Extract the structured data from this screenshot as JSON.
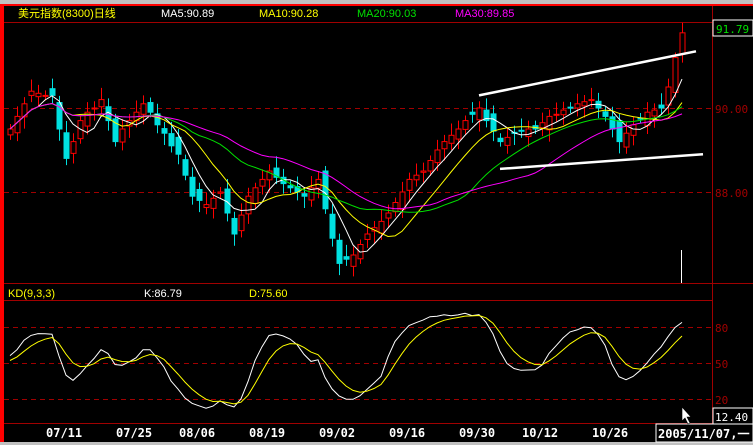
{
  "header": {
    "title": "美元指数(8300)日线",
    "ma5": "MA5:90.89",
    "ma10": "MA10:90.28",
    "ma20": "MA20:90.03",
    "ma30": "MA30:89.85"
  },
  "kd_header": {
    "title": "KD(9,3,3)",
    "k": "K:86.79",
    "d": "D:75.60"
  },
  "price_axis": {
    "current": "91.79",
    "ticks": [
      "90.00",
      "88.00"
    ]
  },
  "kd_axis": {
    "ticks": [
      "80",
      "50",
      "20"
    ]
  },
  "crosshair": {
    "value": "12.40",
    "date": "2005/11/07,一"
  },
  "colors": {
    "up": "#ff0000",
    "down": "#00e0e0",
    "ma5": "#ffffff",
    "ma10": "#ffff00",
    "ma20": "#00e000",
    "ma30": "#ff00ff",
    "grid": "#a00000"
  },
  "chart_data": {
    "type": "candlestick",
    "title": "美元指数(8300)日线",
    "x_labels": [
      "07/11",
      "07/25",
      "08/06",
      "08/19",
      "09/02",
      "09/16",
      "09/30",
      "10/12",
      "10/26"
    ],
    "x_label_index": [
      8,
      18,
      27,
      37,
      47,
      57,
      67,
      76,
      86
    ],
    "ylim": [
      85.8,
      92.0
    ],
    "kd_ylim": [
      0,
      100
    ],
    "closes": [
      89.5,
      89.8,
      90.1,
      90.4,
      90.35,
      90.3,
      90.3,
      89.5,
      88.8,
      89.2,
      89.7,
      89.9,
      90.0,
      90.2,
      89.7,
      89.2,
      89.5,
      89.7,
      89.9,
      90.1,
      89.9,
      89.6,
      89.4,
      89.1,
      88.9,
      88.4,
      87.9,
      87.8,
      87.7,
      87.85,
      88.0,
      87.5,
      87.0,
      87.45,
      87.9,
      88.1,
      88.3,
      88.5,
      88.35,
      88.2,
      88.1,
      88.0,
      87.9,
      88.1,
      88.3,
      87.6,
      86.9,
      86.3,
      86.4,
      86.5,
      86.75,
      87.0,
      87.15,
      87.3,
      87.5,
      87.75,
      88.0,
      88.3,
      88.4,
      88.5,
      88.75,
      89.0,
      89.2,
      89.35,
      89.5,
      89.7,
      89.85,
      90.0,
      89.7,
      89.45,
      89.2,
      89.3,
      89.4,
      89.45,
      89.5,
      89.5,
      89.65,
      89.8,
      89.85,
      89.95,
      90.0,
      90.1,
      90.15,
      90.2,
      90.0,
      89.8,
      89.5,
      89.2,
      89.4,
      89.6,
      89.75,
      89.9,
      89.95,
      90.0,
      90.5,
      91.2,
      91.79
    ],
    "trendlines": [
      {
        "from_index": 67,
        "from_price": 90.3,
        "to_index": 98,
        "to_price": 91.35
      },
      {
        "from_index": 70,
        "from_price": 88.55,
        "to_index": 99,
        "to_price": 88.9
      }
    ]
  }
}
